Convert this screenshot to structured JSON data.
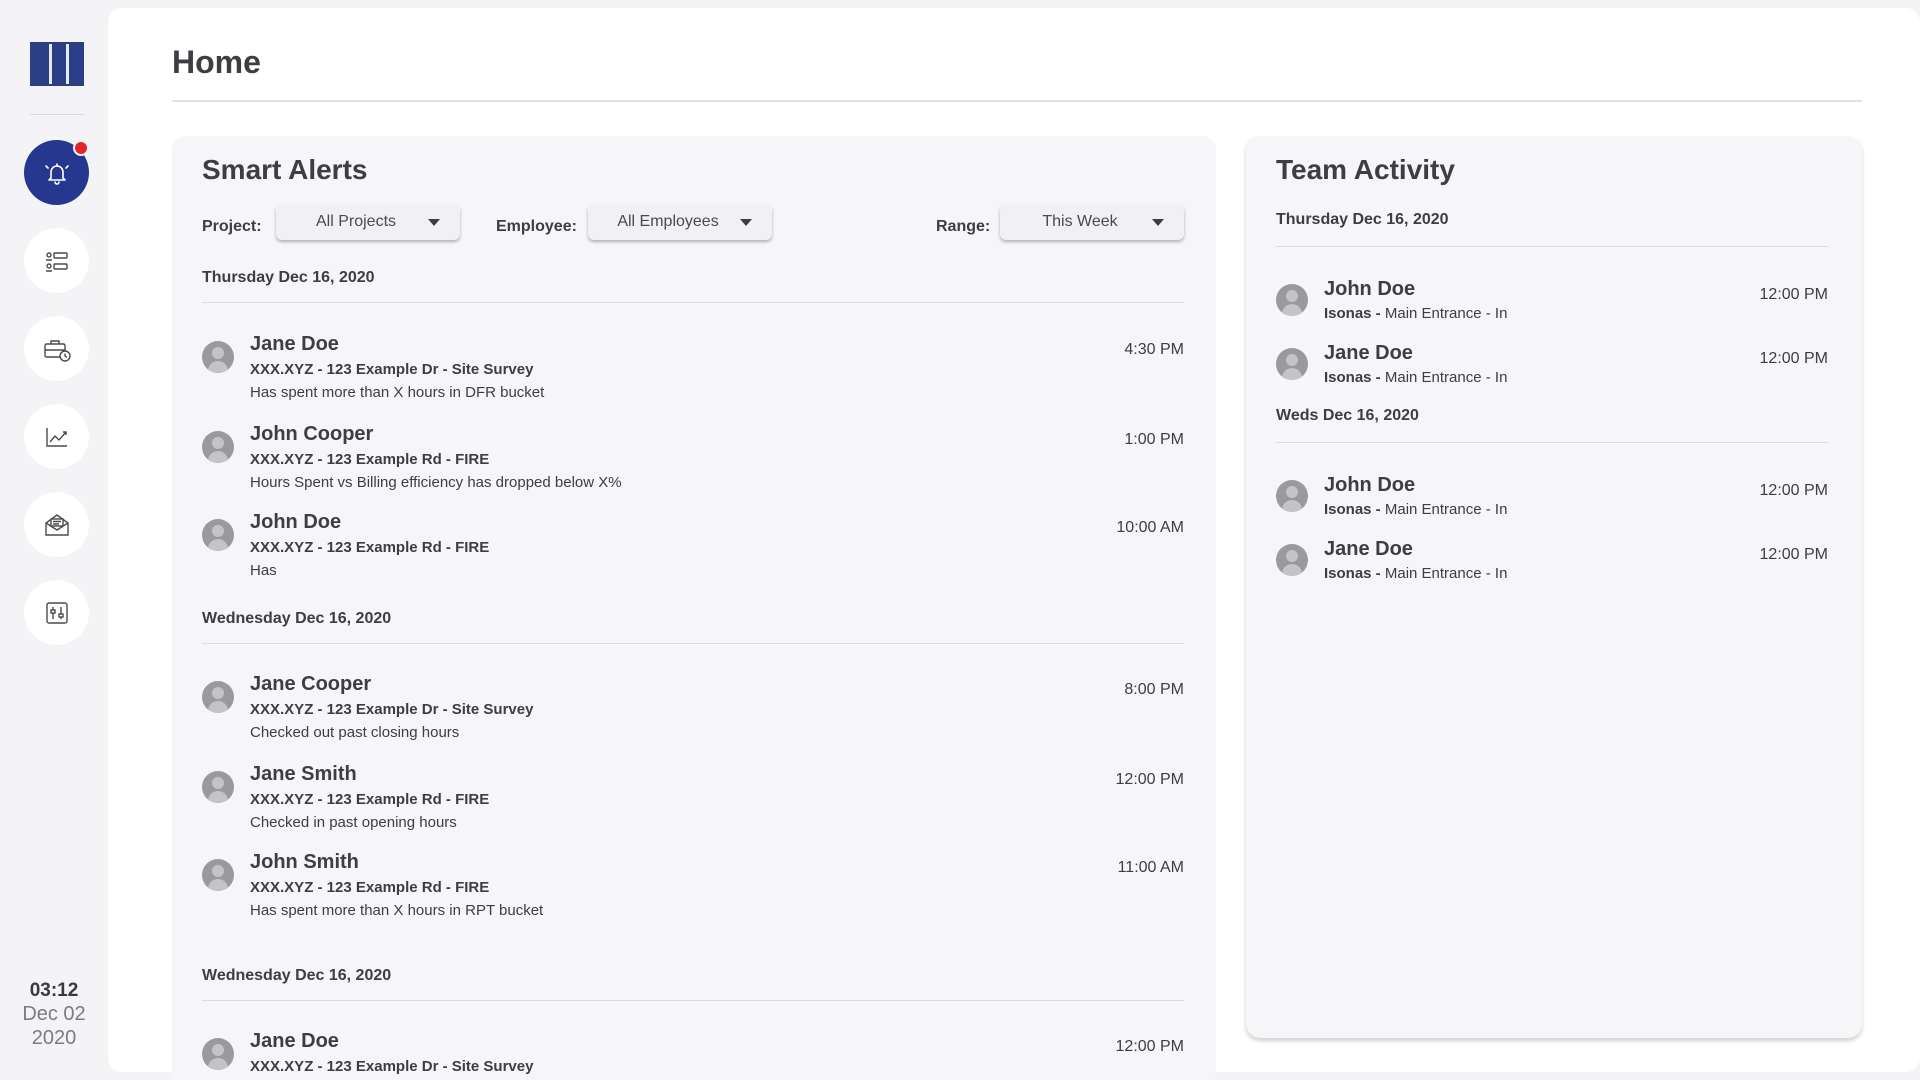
{
  "sidebar": {
    "nav": [
      {
        "icon": "bell-icon",
        "active": true
      },
      {
        "icon": "list-settings-icon",
        "active": false
      },
      {
        "icon": "briefcase-clock-icon",
        "active": false
      },
      {
        "icon": "chart-line-icon",
        "active": false
      },
      {
        "icon": "mail-open-icon",
        "active": false
      },
      {
        "icon": "sliders-box-icon",
        "active": false
      }
    ],
    "clock": {
      "time": "03:12",
      "date": "Dec 02",
      "year": "2020"
    }
  },
  "page": {
    "title": "Home"
  },
  "smart_alerts": {
    "title": "Smart Alerts",
    "filters": {
      "project_label": "Project:",
      "project_value": "All Projects",
      "employee_label": "Employee:",
      "employee_value": "All Employees",
      "range_label": "Range:",
      "range_value": "This Week"
    },
    "groups": [
      {
        "date": "Thursday Dec 16, 2020",
        "items": [
          {
            "name": "Jane Doe",
            "project": "XXX.XYZ - 123 Example Dr - Site Survey",
            "desc": "Has spent more than X hours in DFR bucket",
            "time": "4:30 PM"
          },
          {
            "name": "John Cooper",
            "project": "XXX.XYZ - 123 Example Rd - FIRE",
            "desc": "Hours Spent vs Billing efficiency has dropped below X%",
            "time": "1:00 PM"
          },
          {
            "name": "John Doe",
            "project": "XXX.XYZ - 123 Example Rd - FIRE",
            "desc": "Has",
            "time": "10:00 AM"
          }
        ]
      },
      {
        "date": "Wednesday Dec 16, 2020",
        "items": [
          {
            "name": "Jane Cooper",
            "project": "XXX.XYZ - 123 Example Dr - Site Survey",
            "desc": "Checked out past closing hours",
            "time": "8:00 PM"
          },
          {
            "name": "Jane Smith",
            "project": "XXX.XYZ - 123 Example Rd - FIRE",
            "desc": "Checked in past opening hours",
            "time": "12:00 PM"
          },
          {
            "name": "John Smith",
            "project": "XXX.XYZ - 123 Example Rd - FIRE",
            "desc": "Has spent more than X hours in RPT bucket",
            "time": "11:00 AM"
          }
        ]
      },
      {
        "date": "Wednesday Dec 16, 2020",
        "items": [
          {
            "name": "Jane Doe",
            "project": "XXX.XYZ - 123 Example Dr - Site Survey",
            "desc": "",
            "time": "12:00 PM"
          }
        ]
      }
    ]
  },
  "team_activity": {
    "title": "Team Activity",
    "groups": [
      {
        "date": "Thursday Dec 16, 2020",
        "items": [
          {
            "name": "John Doe",
            "source": "Isonas -",
            "detail": " Main Entrance - In",
            "time": "12:00 PM"
          },
          {
            "name": "Jane Doe",
            "source": "Isonas -",
            "detail": " Main Entrance - In",
            "time": "12:00 PM"
          }
        ]
      },
      {
        "date": "Weds Dec 16, 2020",
        "items": [
          {
            "name": "John Doe",
            "source": "Isonas -",
            "detail": " Main Entrance - In",
            "time": "12:00 PM"
          },
          {
            "name": "Jane Doe",
            "source": "Isonas -",
            "detail": " Main Entrance - In",
            "time": "12:00 PM"
          }
        ]
      }
    ]
  },
  "colors": {
    "accent": "#25378f",
    "alert_dot": "#e0262b",
    "card_bg": "#f6f6f8"
  }
}
